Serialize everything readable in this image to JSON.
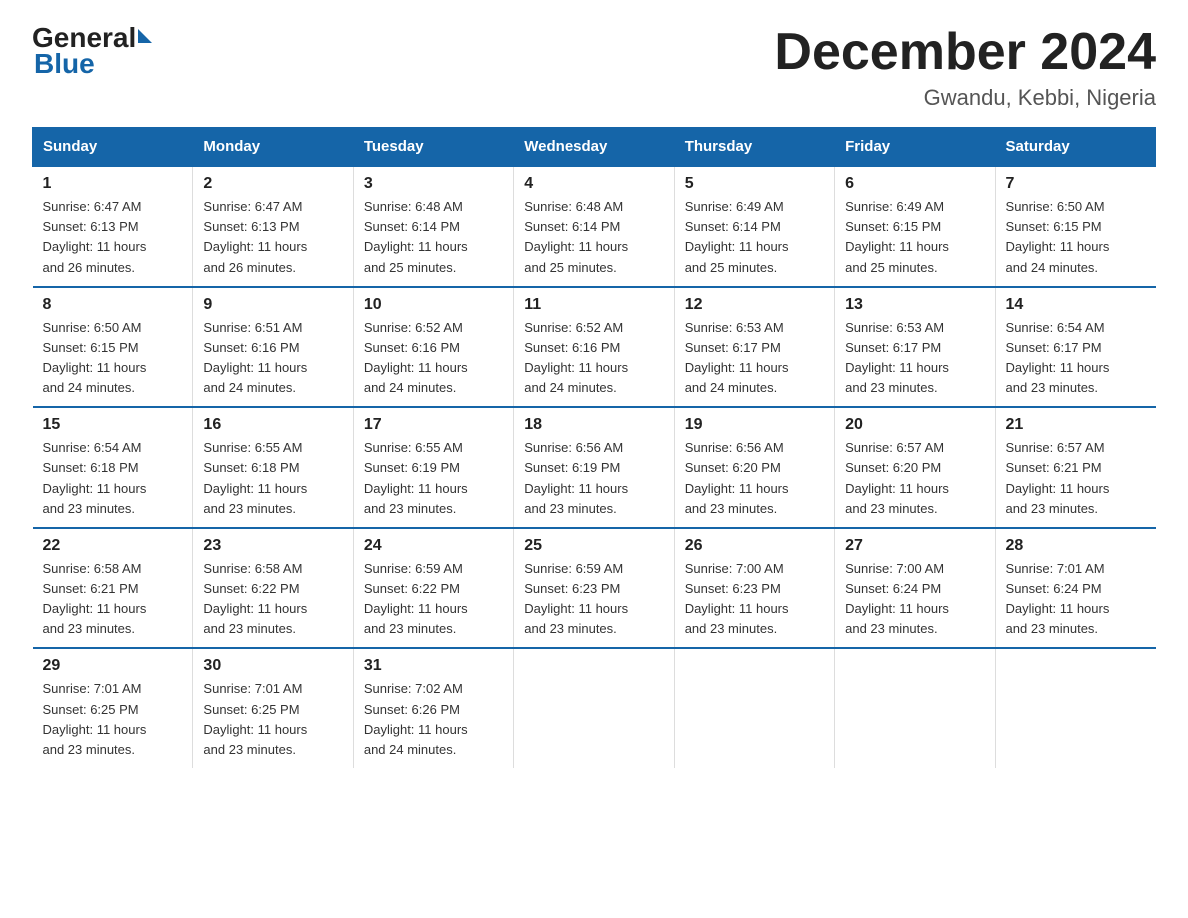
{
  "logo": {
    "general": "General",
    "blue": "Blue"
  },
  "title": "December 2024",
  "location": "Gwandu, Kebbi, Nigeria",
  "days_of_week": [
    "Sunday",
    "Monday",
    "Tuesday",
    "Wednesday",
    "Thursday",
    "Friday",
    "Saturday"
  ],
  "weeks": [
    [
      {
        "day": "1",
        "sunrise": "6:47 AM",
        "sunset": "6:13 PM",
        "daylight": "11 hours and 26 minutes."
      },
      {
        "day": "2",
        "sunrise": "6:47 AM",
        "sunset": "6:13 PM",
        "daylight": "11 hours and 26 minutes."
      },
      {
        "day": "3",
        "sunrise": "6:48 AM",
        "sunset": "6:14 PM",
        "daylight": "11 hours and 25 minutes."
      },
      {
        "day": "4",
        "sunrise": "6:48 AM",
        "sunset": "6:14 PM",
        "daylight": "11 hours and 25 minutes."
      },
      {
        "day": "5",
        "sunrise": "6:49 AM",
        "sunset": "6:14 PM",
        "daylight": "11 hours and 25 minutes."
      },
      {
        "day": "6",
        "sunrise": "6:49 AM",
        "sunset": "6:15 PM",
        "daylight": "11 hours and 25 minutes."
      },
      {
        "day": "7",
        "sunrise": "6:50 AM",
        "sunset": "6:15 PM",
        "daylight": "11 hours and 24 minutes."
      }
    ],
    [
      {
        "day": "8",
        "sunrise": "6:50 AM",
        "sunset": "6:15 PM",
        "daylight": "11 hours and 24 minutes."
      },
      {
        "day": "9",
        "sunrise": "6:51 AM",
        "sunset": "6:16 PM",
        "daylight": "11 hours and 24 minutes."
      },
      {
        "day": "10",
        "sunrise": "6:52 AM",
        "sunset": "6:16 PM",
        "daylight": "11 hours and 24 minutes."
      },
      {
        "day": "11",
        "sunrise": "6:52 AM",
        "sunset": "6:16 PM",
        "daylight": "11 hours and 24 minutes."
      },
      {
        "day": "12",
        "sunrise": "6:53 AM",
        "sunset": "6:17 PM",
        "daylight": "11 hours and 24 minutes."
      },
      {
        "day": "13",
        "sunrise": "6:53 AM",
        "sunset": "6:17 PM",
        "daylight": "11 hours and 23 minutes."
      },
      {
        "day": "14",
        "sunrise": "6:54 AM",
        "sunset": "6:17 PM",
        "daylight": "11 hours and 23 minutes."
      }
    ],
    [
      {
        "day": "15",
        "sunrise": "6:54 AM",
        "sunset": "6:18 PM",
        "daylight": "11 hours and 23 minutes."
      },
      {
        "day": "16",
        "sunrise": "6:55 AM",
        "sunset": "6:18 PM",
        "daylight": "11 hours and 23 minutes."
      },
      {
        "day": "17",
        "sunrise": "6:55 AM",
        "sunset": "6:19 PM",
        "daylight": "11 hours and 23 minutes."
      },
      {
        "day": "18",
        "sunrise": "6:56 AM",
        "sunset": "6:19 PM",
        "daylight": "11 hours and 23 minutes."
      },
      {
        "day": "19",
        "sunrise": "6:56 AM",
        "sunset": "6:20 PM",
        "daylight": "11 hours and 23 minutes."
      },
      {
        "day": "20",
        "sunrise": "6:57 AM",
        "sunset": "6:20 PM",
        "daylight": "11 hours and 23 minutes."
      },
      {
        "day": "21",
        "sunrise": "6:57 AM",
        "sunset": "6:21 PM",
        "daylight": "11 hours and 23 minutes."
      }
    ],
    [
      {
        "day": "22",
        "sunrise": "6:58 AM",
        "sunset": "6:21 PM",
        "daylight": "11 hours and 23 minutes."
      },
      {
        "day": "23",
        "sunrise": "6:58 AM",
        "sunset": "6:22 PM",
        "daylight": "11 hours and 23 minutes."
      },
      {
        "day": "24",
        "sunrise": "6:59 AM",
        "sunset": "6:22 PM",
        "daylight": "11 hours and 23 minutes."
      },
      {
        "day": "25",
        "sunrise": "6:59 AM",
        "sunset": "6:23 PM",
        "daylight": "11 hours and 23 minutes."
      },
      {
        "day": "26",
        "sunrise": "7:00 AM",
        "sunset": "6:23 PM",
        "daylight": "11 hours and 23 minutes."
      },
      {
        "day": "27",
        "sunrise": "7:00 AM",
        "sunset": "6:24 PM",
        "daylight": "11 hours and 23 minutes."
      },
      {
        "day": "28",
        "sunrise": "7:01 AM",
        "sunset": "6:24 PM",
        "daylight": "11 hours and 23 minutes."
      }
    ],
    [
      {
        "day": "29",
        "sunrise": "7:01 AM",
        "sunset": "6:25 PM",
        "daylight": "11 hours and 23 minutes."
      },
      {
        "day": "30",
        "sunrise": "7:01 AM",
        "sunset": "6:25 PM",
        "daylight": "11 hours and 23 minutes."
      },
      {
        "day": "31",
        "sunrise": "7:02 AM",
        "sunset": "6:26 PM",
        "daylight": "11 hours and 24 minutes."
      },
      null,
      null,
      null,
      null
    ]
  ],
  "labels": {
    "sunrise": "Sunrise:",
    "sunset": "Sunset:",
    "daylight": "Daylight:"
  }
}
